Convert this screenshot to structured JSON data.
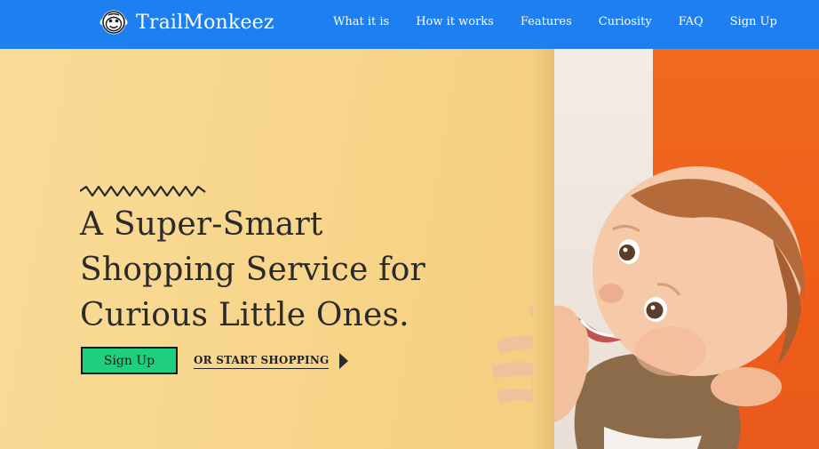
{
  "header": {
    "brand_name": "TrailMonkeez",
    "nav": [
      {
        "label": "What it is"
      },
      {
        "label": "How it works"
      },
      {
        "label": "Features"
      },
      {
        "label": "Curiosity"
      },
      {
        "label": "FAQ"
      },
      {
        "label": "Sign Up"
      }
    ]
  },
  "hero": {
    "headline_lines": [
      "A Super-Smart",
      "Shopping Service for",
      "Curious Little Ones."
    ],
    "signup_label": "Sign Up",
    "shop_label": "OR START SHOPPING",
    "image": "smiling-baby-peeking-around-wall"
  },
  "colors": {
    "header_bg": "#1e7ff0",
    "cta_green": "#1ecf7e",
    "wall_yellow": "#f7d88c",
    "wall_orange": "#f06a20"
  }
}
